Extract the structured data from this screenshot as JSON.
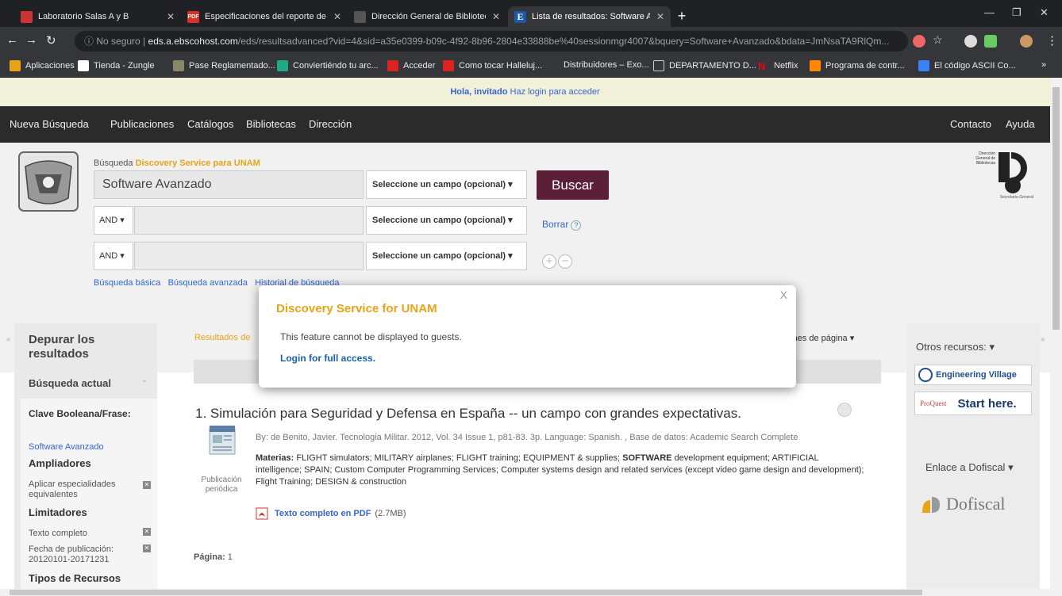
{
  "browser": {
    "tabs": [
      {
        "title": "Laboratorio Salas A y B",
        "active": false
      },
      {
        "title": "Especificaciones del reporte de l",
        "active": false,
        "badge": "PDF"
      },
      {
        "title": "Dirección General de Bibliotecas,",
        "active": false
      },
      {
        "title": "Lista de resultados: Software Ava",
        "active": true,
        "badge": "E"
      }
    ],
    "url_prefix": "No seguro",
    "url_host": "eds.a.ebscohost.com",
    "url_path": "/eds/resultsadvanced?vid=4&sid=a35e0399-b09c-4f92-8b96-2804e33888be%40sessionmgr4007&bquery=Software+Avanzado&bdata=JmNsaTA9RlQm...",
    "bookmarks": [
      "Aplicaciones",
      "Tienda - Zungle",
      "Pase Reglamentado...",
      "Conviertiéndo tu arc...",
      "Acceder",
      "Como tocar Halleluj...",
      "Distribuidores – Exo...",
      "DEPARTAMENTO D...",
      "Netflix",
      "Programa de contr...",
      "El código ASCII Co..."
    ],
    "bookmarks_more": "»"
  },
  "guest_bar": {
    "hello": "Hola, invitado",
    "login": "Haz login para acceder"
  },
  "nav": {
    "left": [
      "Nueva Búsqueda",
      "Publicaciones",
      "Catálogos",
      "Bibliotecas",
      "Dirección"
    ],
    "right": [
      "Contacto",
      "Ayuda"
    ]
  },
  "search": {
    "label_prefix": "Búsqueda",
    "label_service": "Discovery Service para UNAM",
    "query": "Software Avanzado",
    "field_select": "Seleccione un campo (opcional)",
    "operator": "AND",
    "search_button": "Buscar",
    "clear": "Borrar",
    "help": "?",
    "links": [
      "Búsqueda básica",
      "Búsqueda avanzada",
      "Historial de búsqueda"
    ]
  },
  "dgb": {
    "lines": [
      "Dirección",
      "General de",
      "Bibliotecas"
    ],
    "footer": "Secretaría General"
  },
  "sidebar": {
    "title": "Depurar los resultados",
    "current": "Búsqueda actual",
    "boolean_heading": "Clave Booleana/Frase:",
    "boolean_value": "Software Avanzado",
    "amplifiers": "Ampliadores",
    "amplifier_item": "Aplicar especialidades equivalentes",
    "limiters": "Limitadores",
    "limiter_full": "Texto completo",
    "limiter_date": "Fecha de publicación: 20120101-20171231",
    "resource_types": "Tipos de Recursos"
  },
  "results": {
    "header": "Resultados de",
    "page_options": "iones de página",
    "item": {
      "number": "1.",
      "title": "Simulación para Seguridad y Defensa en España -- un campo con grandes expectativas.",
      "meta": "By: de Benito, Javier. Tecnologia Militar. 2012, Vol. 34 Issue 1, p81-83. 3p. Language: Spanish. , Base de datos: Academic Search Complete",
      "subjects_label": "Materias:",
      "subjects_1": " FLIGHT simulators; MILITARY airplanes; FLIGHT training; EQUIPMENT & supplies; ",
      "subjects_bold": "SOFTWARE",
      "subjects_2": " development equipment; ARTIFICIAL intelligence; SPAIN; Custom Computer Programming Services; Computer systems design and related services (except video game design and development); Flight Training; DESIGN & construction",
      "pub_type": "Publicación periódica",
      "pdf_link": "Texto completo en PDF",
      "pdf_size": "(2.7MB)"
    },
    "page_label": "Página:",
    "page_value": "1"
  },
  "right": {
    "other_resources": "Otros recursos:",
    "engineering_village": "Engineering Village",
    "proquest": "ProQuest",
    "start_here": "Start here.",
    "dofiscal_link": "Enlace a Dofiscal",
    "dofiscal": "Dofiscal"
  },
  "modal": {
    "title": "Discovery Service for UNAM",
    "message": "This feature cannot be displayed to guests.",
    "link": "Login for full access.",
    "close": "X"
  }
}
